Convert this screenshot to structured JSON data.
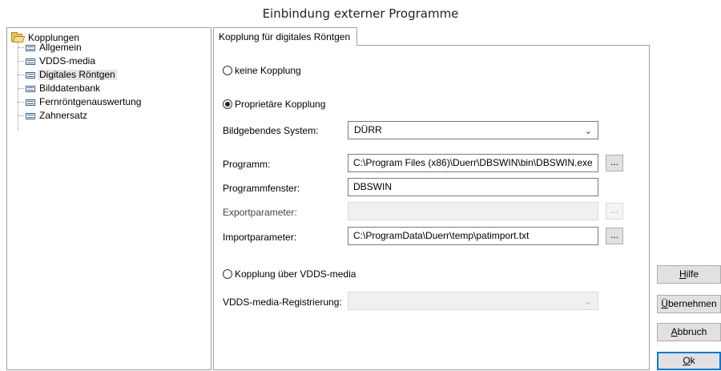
{
  "window": {
    "title": "Einbindung externer Programme"
  },
  "tree": {
    "root": "Kopplungen",
    "items": [
      {
        "label": "Allgemein",
        "selected": false
      },
      {
        "label": "VDDS-media",
        "selected": false
      },
      {
        "label": "Digitales Röntgen",
        "selected": true
      },
      {
        "label": "Bilddatenbank",
        "selected": false
      },
      {
        "label": "Fernröntgenauswertung",
        "selected": false
      },
      {
        "label": "Zahnersatz",
        "selected": false
      }
    ]
  },
  "tab": {
    "label": "Kopplung für digitales Röntgen"
  },
  "form": {
    "option_none": "keine Kopplung",
    "option_proprietary": "Proprietäre Kopplung",
    "option_vdds": "Kopplung über VDDS-media",
    "selected_option": "proprietary",
    "imaging_system_label": "Bildgebendes System:",
    "imaging_system_value": "DÜRR",
    "program_label": "Programm:",
    "program_value": "C:\\Program Files (x86)\\Duerr\\DBSWIN\\bin\\DBSWIN.exe",
    "window_label": "Programmfenster:",
    "window_value": "DBSWIN",
    "export_label": "Exportparameter:",
    "export_value": "",
    "import_label": "Importparameter:",
    "import_value": "C:\\ProgramData\\Duerr\\temp\\patimport.txt",
    "browse_label": "...",
    "vdds_reg_label": "VDDS-media-Registrierung:",
    "vdds_reg_value": ""
  },
  "buttons": {
    "help": {
      "mnemonic": "H",
      "rest": "ilfe"
    },
    "apply": {
      "mnemonic": "Ü",
      "rest": "bernehmen"
    },
    "cancel": {
      "mnemonic": "A",
      "rest": "bbruch"
    },
    "ok": {
      "mnemonic": "O",
      "rest": "k"
    }
  },
  "icons": {
    "folder": "folder-open-icon",
    "item": "list-item-icon",
    "dropdown": "chevron-down-icon"
  },
  "colors": {
    "accent": "#0078d7",
    "selection": "#e6e6e6"
  }
}
